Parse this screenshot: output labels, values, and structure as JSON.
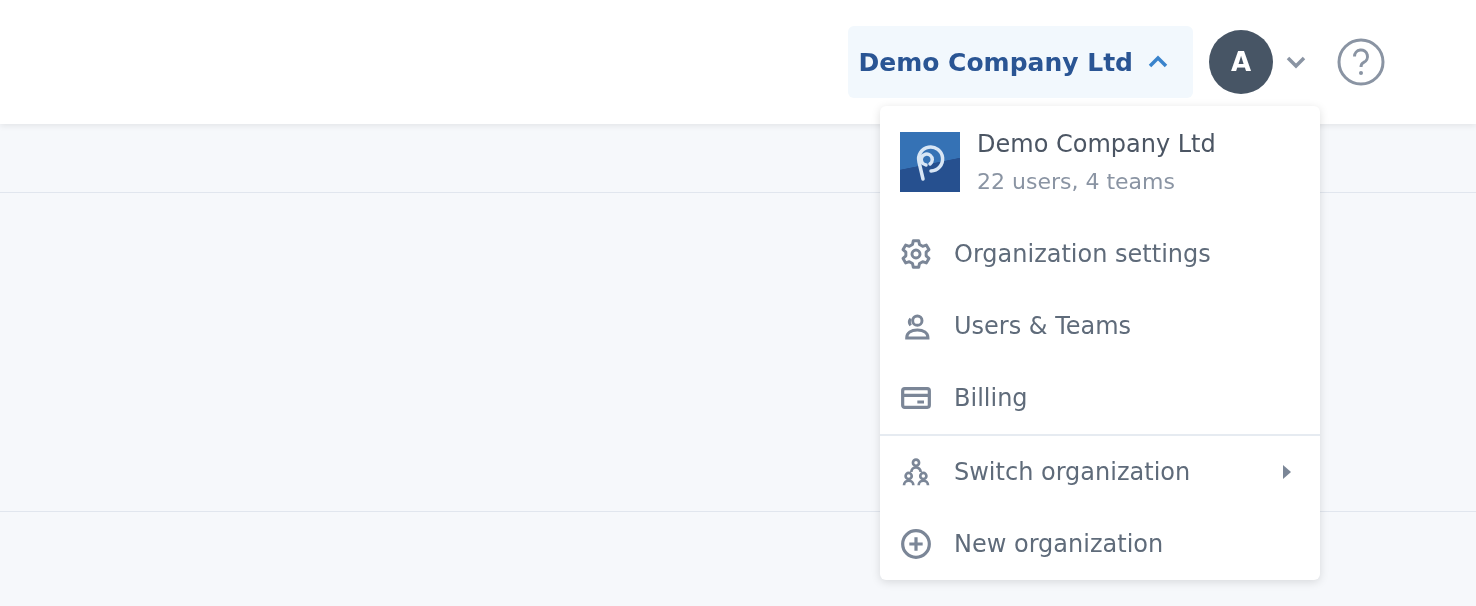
{
  "header": {
    "org_switcher": {
      "label": "Demo Company Ltd",
      "expanded": true
    },
    "avatar": {
      "initial": "A"
    }
  },
  "org_menu": {
    "org": {
      "name": "Demo Company Ltd",
      "details": "22 users, 4 teams"
    },
    "sections": [
      [
        {
          "kind": "settings",
          "label": "Organization settings",
          "submenu": false
        },
        {
          "kind": "users",
          "label": "Users & Teams",
          "submenu": false
        },
        {
          "kind": "billing",
          "label": "Billing",
          "submenu": false
        }
      ],
      [
        {
          "kind": "switch",
          "label": "Switch organization",
          "submenu": true
        },
        {
          "kind": "new",
          "label": "New organization",
          "submenu": false
        }
      ]
    ]
  }
}
